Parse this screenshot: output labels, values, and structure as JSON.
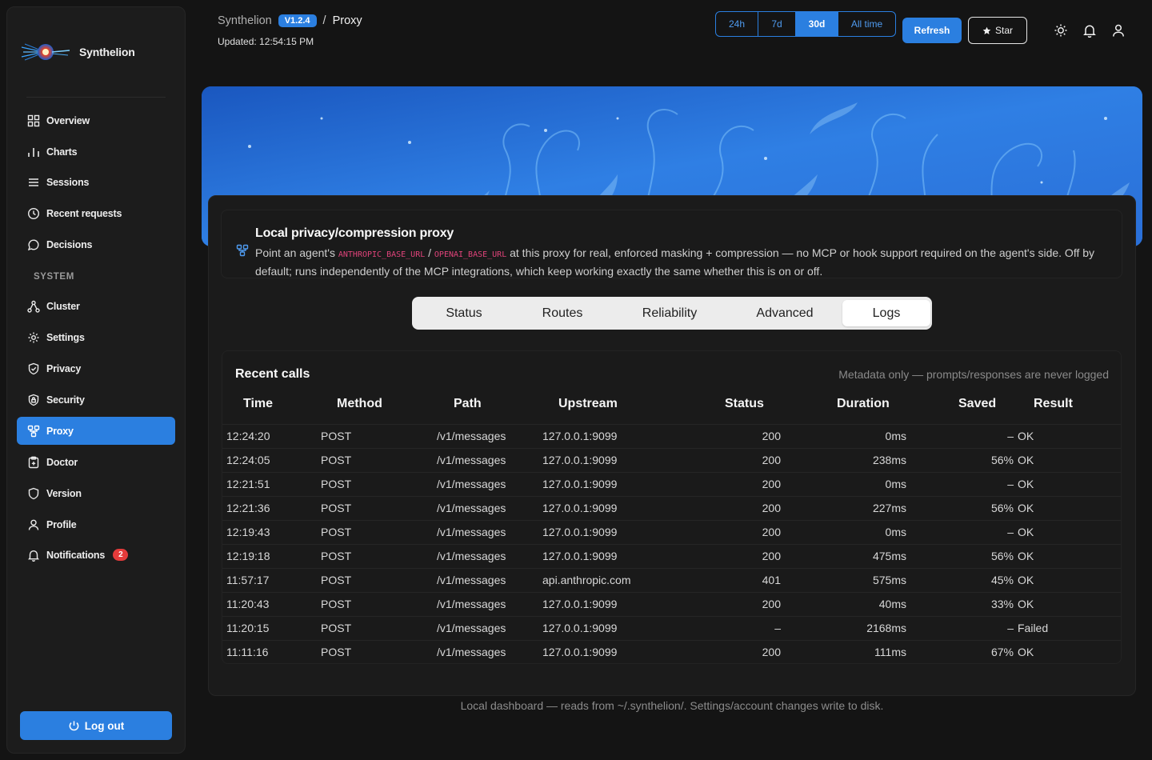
{
  "brand": {
    "name": "Synthelion"
  },
  "sidebar": {
    "items": [
      {
        "label": "Overview",
        "icon": "grid-icon"
      },
      {
        "label": "Charts",
        "icon": "bar-chart-icon"
      },
      {
        "label": "Sessions",
        "icon": "list-icon"
      },
      {
        "label": "Recent requests",
        "icon": "clock-icon"
      },
      {
        "label": "Decisions",
        "icon": "chat-icon"
      }
    ],
    "section_label": "SYSTEM",
    "system_items": [
      {
        "label": "Cluster",
        "icon": "cluster-icon"
      },
      {
        "label": "Settings",
        "icon": "gear-icon"
      },
      {
        "label": "Privacy",
        "icon": "shield-check-icon"
      },
      {
        "label": "Security",
        "icon": "shield-lock-icon"
      },
      {
        "label": "Proxy",
        "icon": "proxy-icon",
        "active": true
      },
      {
        "label": "Doctor",
        "icon": "clipboard-icon"
      },
      {
        "label": "Version",
        "icon": "shield-icon"
      },
      {
        "label": "Profile",
        "icon": "user-icon"
      },
      {
        "label": "Notifications",
        "icon": "bell-icon",
        "badge": "2"
      }
    ],
    "logout_label": "Log out"
  },
  "header": {
    "app": "Synthelion",
    "version": "V1.2.4",
    "separator": "/",
    "page": "Proxy",
    "updated": "Updated: 12:54:15 PM",
    "ranges": [
      "24h",
      "7d",
      "30d",
      "All time"
    ],
    "selected_range": "30d",
    "refresh_label": "Refresh",
    "star_label": "Star"
  },
  "info": {
    "title": "Local privacy/compression proxy",
    "text_before": "Point an agent's ",
    "code1": "ANTHROPIC_BASE_URL",
    "slash": " / ",
    "code2": "OPENAI_BASE_URL",
    "text_after": " at this proxy for real, enforced masking + compression — no MCP or hook support required on the agent's side. Off by default; runs independently of the MCP integrations, which keep working exactly the same whether this is on or off."
  },
  "tabs": [
    "Status",
    "Routes",
    "Reliability",
    "Advanced",
    "Logs"
  ],
  "selected_tab": "Logs",
  "recent_calls": {
    "title": "Recent calls",
    "note": "Metadata only — prompts/responses are never logged",
    "columns": [
      "Time",
      "Method",
      "Path",
      "Upstream",
      "Status",
      "Duration",
      "Saved",
      "Result"
    ],
    "rows": [
      [
        "12:24:20",
        "POST",
        "/v1/messages",
        "127.0.0.1:9099",
        "200",
        "0ms",
        "–",
        "OK"
      ],
      [
        "12:24:05",
        "POST",
        "/v1/messages",
        "127.0.0.1:9099",
        "200",
        "238ms",
        "56%",
        "OK"
      ],
      [
        "12:21:51",
        "POST",
        "/v1/messages",
        "127.0.0.1:9099",
        "200",
        "0ms",
        "–",
        "OK"
      ],
      [
        "12:21:36",
        "POST",
        "/v1/messages",
        "127.0.0.1:9099",
        "200",
        "227ms",
        "56%",
        "OK"
      ],
      [
        "12:19:43",
        "POST",
        "/v1/messages",
        "127.0.0.1:9099",
        "200",
        "0ms",
        "–",
        "OK"
      ],
      [
        "12:19:18",
        "POST",
        "/v1/messages",
        "127.0.0.1:9099",
        "200",
        "475ms",
        "56%",
        "OK"
      ],
      [
        "11:57:17",
        "POST",
        "/v1/messages",
        "api.anthropic.com",
        "401",
        "575ms",
        "45%",
        "OK"
      ],
      [
        "11:20:43",
        "POST",
        "/v1/messages",
        "127.0.0.1:9099",
        "200",
        "40ms",
        "33%",
        "OK"
      ],
      [
        "11:20:15",
        "POST",
        "/v1/messages",
        "127.0.0.1:9099",
        "–",
        "2168ms",
        "–",
        "Failed"
      ],
      [
        "11:11:16",
        "POST",
        "/v1/messages",
        "127.0.0.1:9099",
        "200",
        "111ms",
        "67%",
        "OK"
      ]
    ]
  },
  "footer": "Local dashboard — reads from ~/.synthelion/. Settings/account changes write to disk.",
  "colors": {
    "accent": "#2b7fe0",
    "badge": "#e43b3b",
    "code": "#e0437a"
  }
}
